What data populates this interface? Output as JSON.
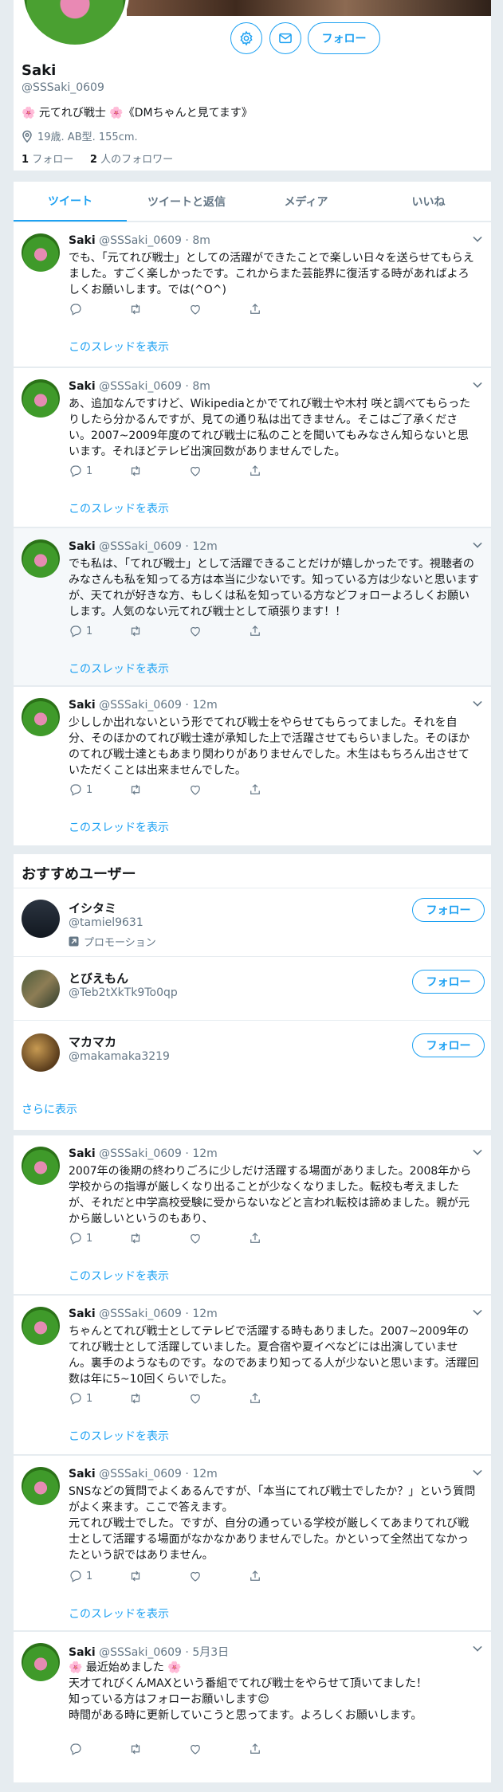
{
  "profile": {
    "name": "Saki",
    "handle": "@SSSaki_0609",
    "bio": "🌸 元てれび戦士 🌸《DMちゃんと見てます》",
    "location": "19歳. AB型. 155cm.",
    "following_count": "1",
    "following_label": "フォロー",
    "followers_count": "2",
    "followers_label": "人のフォロワー",
    "follow_label": "フォロー"
  },
  "tabs": [
    "ツイート",
    "ツイートと返信",
    "メディア",
    "いいね"
  ],
  "thread_label": "このスレッドを表示",
  "tweets": [
    {
      "name": "Saki",
      "handle": "@SSSaki_0609",
      "time": "8m",
      "text": "でも、「元てれび戦士」としての活躍ができたことで楽しい日々を送らせてもらえました。すごく楽しかったです。これからまた芸能界に復活する時があればよろしくお願いします。では(^O^)",
      "replies": ""
    },
    {
      "name": "Saki",
      "handle": "@SSSaki_0609",
      "time": "8m",
      "text": "あ、追加なんですけど、Wikipediaとかでてれび戦士や木村 咲と調べてもらったりしたら分かるんですが、見ての通り私は出てきません。そこはご了承ください。2007~2009年度のてれび戦士に私のことを聞いてもみなさん知らないと思います。それほどテレビ出演回数がありませんでした。",
      "replies": "1"
    },
    {
      "name": "Saki",
      "handle": "@SSSaki_0609",
      "time": "12m",
      "text": "でも私は、「てれび戦士」として活躍できることだけが嬉しかったです。視聴者のみなさんも私を知ってる方は本当に少ないです。知っている方は少ないと思いますが、天てれが好きな方、もしくは私を知っている方などフォローよろしくお願いします。人気のない元てれび戦士として頑張ります！！",
      "replies": "1"
    },
    {
      "name": "Saki",
      "handle": "@SSSaki_0609",
      "time": "12m",
      "text": "少ししか出れないという形でてれび戦士をやらせてもらってました。それを自分、そのほかのてれび戦士達が承知した上で活躍させてもらいました。そのほかのてれび戦士達ともあまり関わりがありませんでした。木生はもちろん出させていただくことは出来ませんでした。",
      "replies": "1"
    },
    {
      "name": "Saki",
      "handle": "@SSSaki_0609",
      "time": "12m",
      "text": "2007年の後期の終わりごろに少しだけ活躍する場面がありました。2008年から学校からの指導が厳しくなり出ることが少なくなりました。転校も考えましたが、それだと中学高校受験に受からないなどと言われ転校は諦めました。親が元から厳しいというのもあり、",
      "replies": "1"
    },
    {
      "name": "Saki",
      "handle": "@SSSaki_0609",
      "time": "12m",
      "text": "ちゃんとてれび戦士としてテレビで活躍する時もありました。2007~2009年のてれび戦士として活躍していました。夏合宿や夏イベなどには出演していません。裏手のようなものです。なのであまり知ってる人が少ないと思います。活躍回数は年に5~10回くらいでした。",
      "replies": "1"
    },
    {
      "name": "Saki",
      "handle": "@SSSaki_0609",
      "time": "12m",
      "text": "SNSなどの質問でよくあるんですが、「本当にてれび戦士でしたか？」という質問がよく来ます。ここで答えます。\n元てれび戦士でした。ですが、自分の通っている学校が厳しくてあまりてれび戦士として活躍する場面がなかなかありませんでした。かといって全然出てなかったという訳ではありません。",
      "replies": "1"
    },
    {
      "name": "Saki",
      "handle": "@SSSaki_0609",
      "time": "5月3日",
      "text": "🌸 最近始めました 🌸\n天才てれびくんMAXという番組でてれび戦士をやらせて頂いてました！\n知っている方はフォローお願いします😌\n時間がある時に更新していこうと思ってます。よろしくお願いします。",
      "replies": ""
    }
  ],
  "wtf": {
    "title": "おすすめユーザー",
    "promo_label": "プロモーション",
    "follow_label": "フォロー",
    "show_more": "さらに表示",
    "users": [
      {
        "name": "イシタミ",
        "handle": "@tamiel9631"
      },
      {
        "name": "とびえもん",
        "handle": "@Teb2tXkTk9To0qp"
      },
      {
        "name": "マカマカ",
        "handle": "@makamaka3219"
      }
    ]
  },
  "colors": {
    "accent": "#1da1f2",
    "bg": "#e6ecf0",
    "muted": "#657786"
  },
  "icons": [
    "gear-icon",
    "mail-icon",
    "location-pin-icon",
    "reply-icon",
    "retweet-icon",
    "like-icon",
    "share-icon",
    "chevron-down-icon",
    "promoted-icon"
  ]
}
